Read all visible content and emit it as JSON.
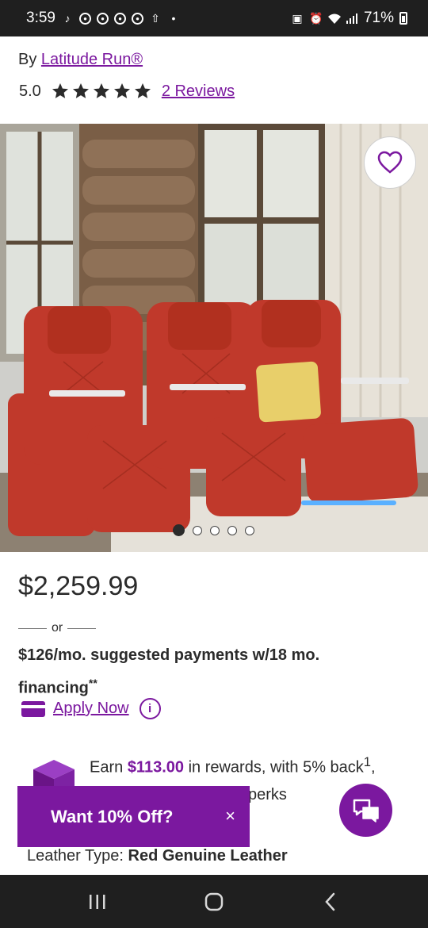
{
  "status_bar": {
    "time": "3:59",
    "battery": "71%",
    "icons": [
      "tiktok-icon",
      "chrome-icon",
      "chrome-icon",
      "chrome-icon",
      "chrome-icon",
      "upload-icon",
      "dot-icon",
      "nfc-icon",
      "alarm-icon",
      "wifi-icon",
      "signal-icon",
      "battery-icon"
    ]
  },
  "product": {
    "byline_prefix": "By",
    "brand": "Latitude Run®",
    "rating_value": "5.0",
    "rating_stars": 5,
    "reviews_link": "2 Reviews",
    "price": "$2,259.99",
    "or_text": "or",
    "financing_text": "$126/mo. suggested payments w/18 mo. financing",
    "financing_mark": "**",
    "apply_now": "Apply Now",
    "rewards_prefix": "Earn",
    "rewards_amount": "$113.00",
    "rewards_suffix": "in rewards, with 5% back",
    "rewards_mark": "1",
    "rewards_line2": "perks",
    "leather_label": "Leather Type:",
    "leather_value": "Red Genuine Leather"
  },
  "carousel": {
    "total": 5,
    "active_index": 0
  },
  "promo": {
    "label": "Want 10% Off?",
    "close": "×"
  },
  "colors": {
    "brand_purple": "#7b189f",
    "text": "#2b2b2b",
    "system_bar": "#1f1f1f"
  }
}
